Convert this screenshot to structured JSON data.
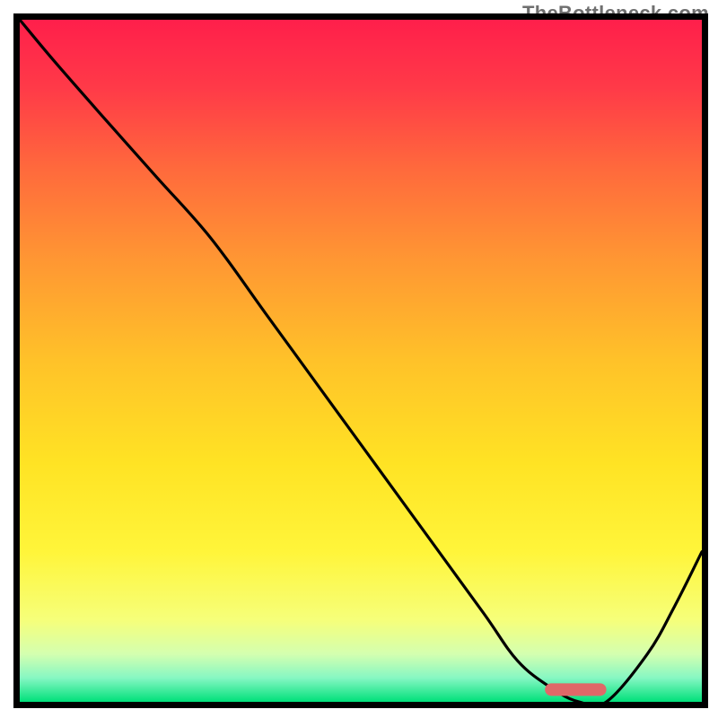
{
  "attribution": "TheBottleneck.com",
  "chart_data": {
    "type": "line",
    "title": "",
    "xlabel": "",
    "ylabel": "",
    "xlim": [
      0,
      100
    ],
    "ylim": [
      0,
      100
    ],
    "x": [
      0,
      5,
      12,
      20,
      28,
      36,
      44,
      52,
      60,
      68,
      73,
      78,
      82,
      86,
      92,
      96,
      100
    ],
    "values": [
      100,
      94,
      86,
      77,
      68,
      57,
      46,
      35,
      24,
      13,
      6,
      2,
      0,
      0,
      7,
      14,
      22
    ],
    "marker": {
      "x_start": 77,
      "x_end": 86,
      "y": 1.8
    },
    "gradient_stops": [
      {
        "offset": 0.0,
        "color": "#ff1f4b"
      },
      {
        "offset": 0.1,
        "color": "#ff3a48"
      },
      {
        "offset": 0.22,
        "color": "#ff6a3c"
      },
      {
        "offset": 0.35,
        "color": "#ff9633"
      },
      {
        "offset": 0.5,
        "color": "#ffc229"
      },
      {
        "offset": 0.65,
        "color": "#ffe324"
      },
      {
        "offset": 0.78,
        "color": "#fff53a"
      },
      {
        "offset": 0.88,
        "color": "#f6ff7a"
      },
      {
        "offset": 0.93,
        "color": "#d4ffb0"
      },
      {
        "offset": 0.965,
        "color": "#86f7c3"
      },
      {
        "offset": 1.0,
        "color": "#00e07a"
      }
    ],
    "border_color": "#000000",
    "line_color": "#000000",
    "marker_color": "#e06868"
  }
}
